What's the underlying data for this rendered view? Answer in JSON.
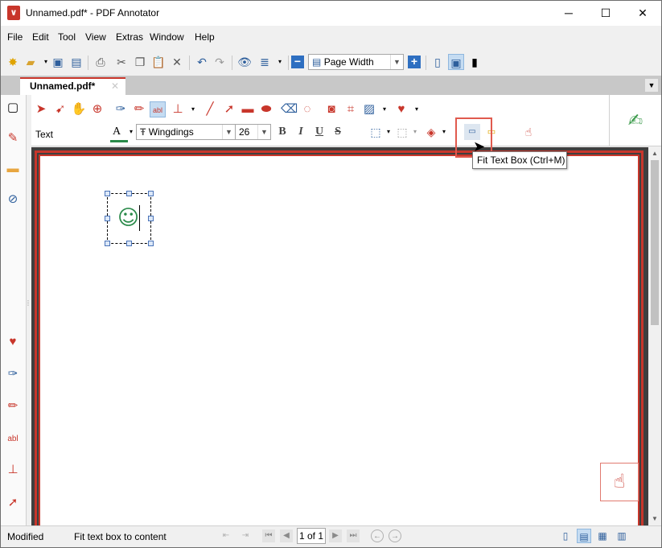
{
  "window": {
    "title": "Unnamed.pdf* - PDF Annotator",
    "minimize": "─",
    "maximize": "☐",
    "close": "✕"
  },
  "menu": [
    "File",
    "Edit",
    "Tool",
    "View",
    "Extras",
    "Window",
    "Help"
  ],
  "toolbar": {
    "zoom_value": "Page Width"
  },
  "tabs": {
    "active_tab": "Unnamed.pdf*",
    "close": "✕"
  },
  "annotation_toolbar": {
    "tool_label": "Text",
    "font_name": "Wingdings",
    "font_size": "26",
    "bold": "B",
    "italic": "I",
    "underline": "U",
    "strike": "S"
  },
  "tooltip": "Fit Text Box (Ctrl+M)",
  "page": {
    "textbox_content": "☺"
  },
  "status": {
    "state": "Modified",
    "hint": "Fit text box to content",
    "page_indicator": "1 of 1"
  },
  "colors": {
    "accent": "#c8362b",
    "font_color_bar": "#2a8a4a"
  }
}
